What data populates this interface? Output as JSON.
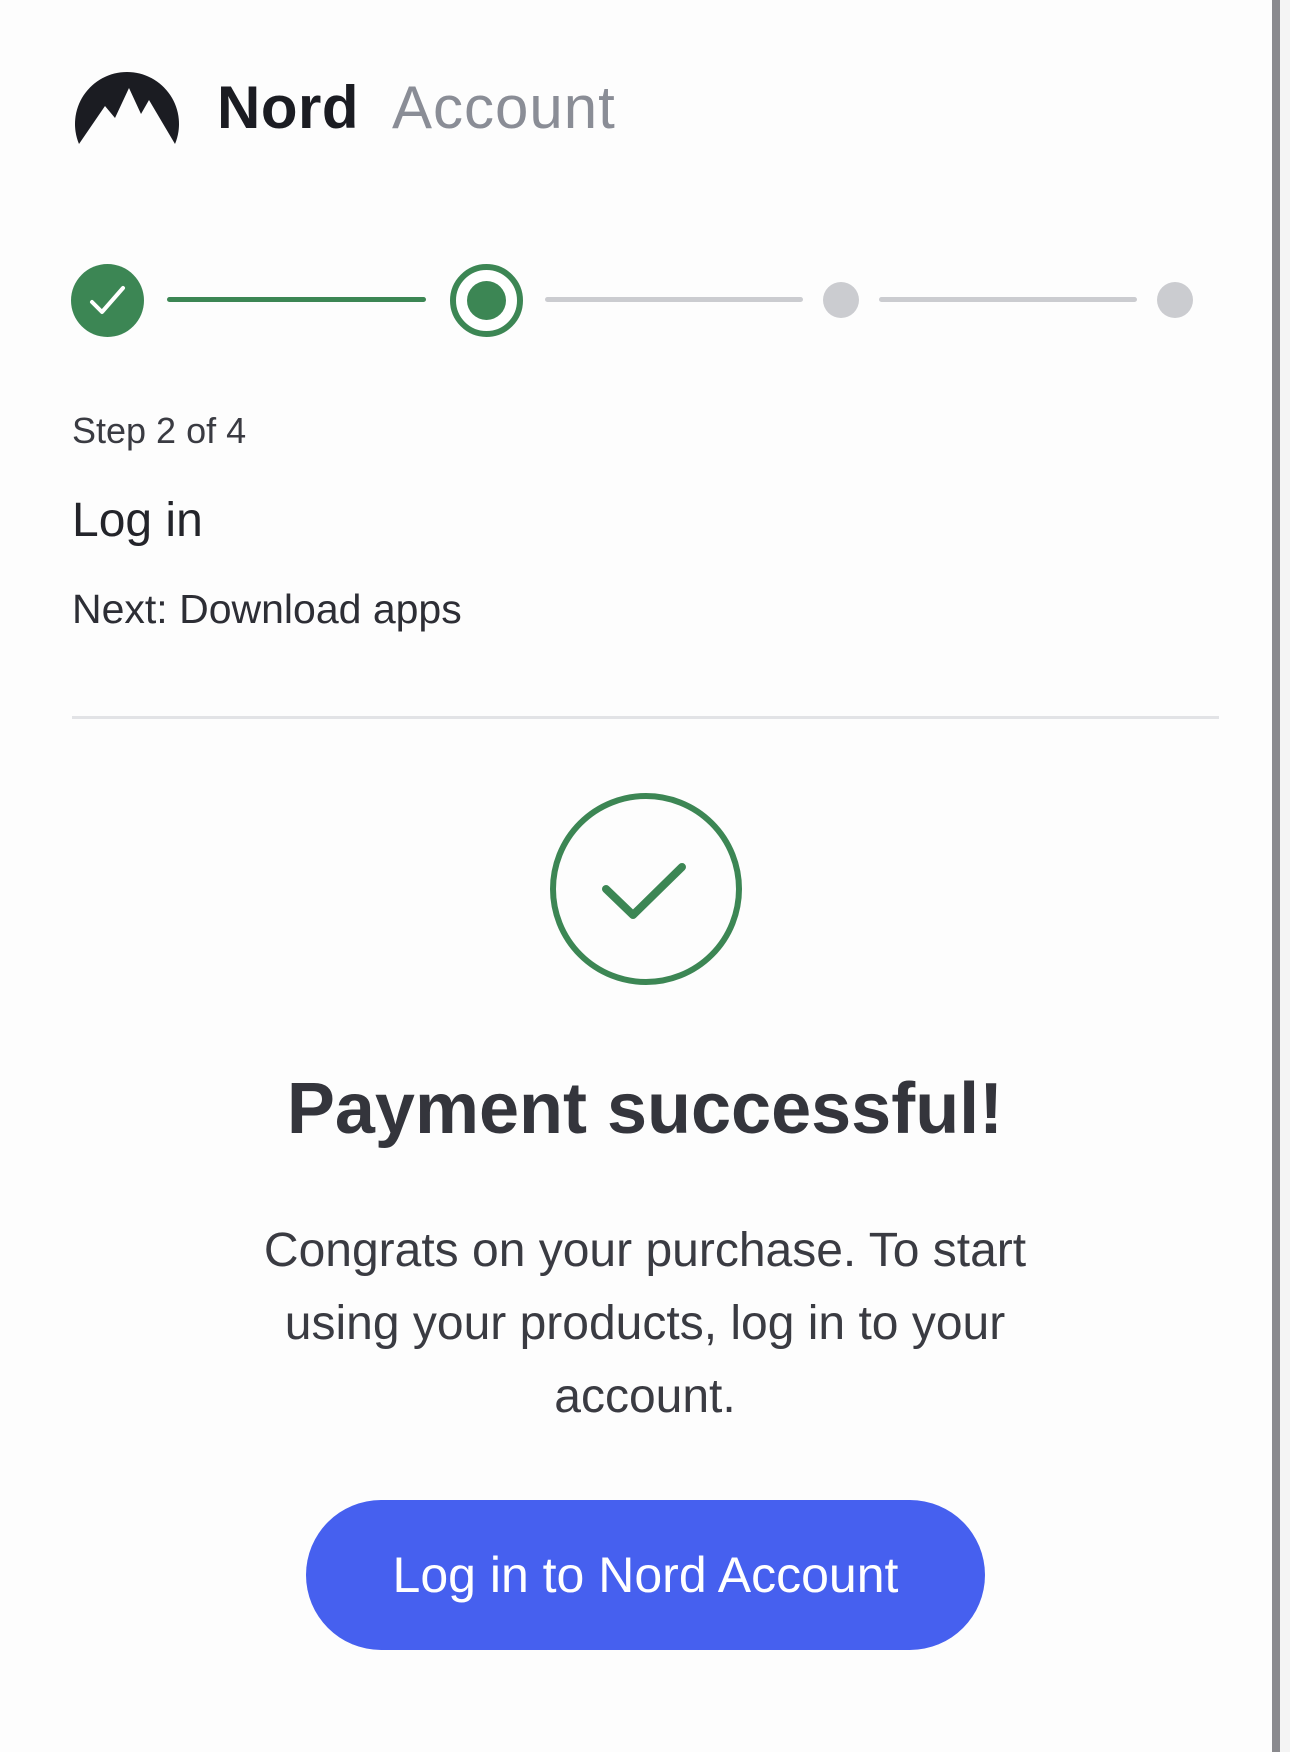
{
  "header": {
    "brand_primary": "Nord",
    "brand_secondary": "Account",
    "logo_icon": "nord-mountain-logo"
  },
  "stepper": {
    "total_steps": 4,
    "current_step": 2,
    "completed_steps": 1,
    "step_count_label": "Step 2 of 4",
    "current_title": "Log in",
    "next_label": "Next: Download apps",
    "colors": {
      "active": "#3c8654",
      "inactive": "#cbccd0"
    }
  },
  "success": {
    "icon": "check-circle-icon",
    "title": "Payment successful!",
    "body": "Congrats on your purchase. To start using your products, log in to your account.",
    "button_label": "Log in to Nord Account",
    "button_color": "#4660ef"
  }
}
